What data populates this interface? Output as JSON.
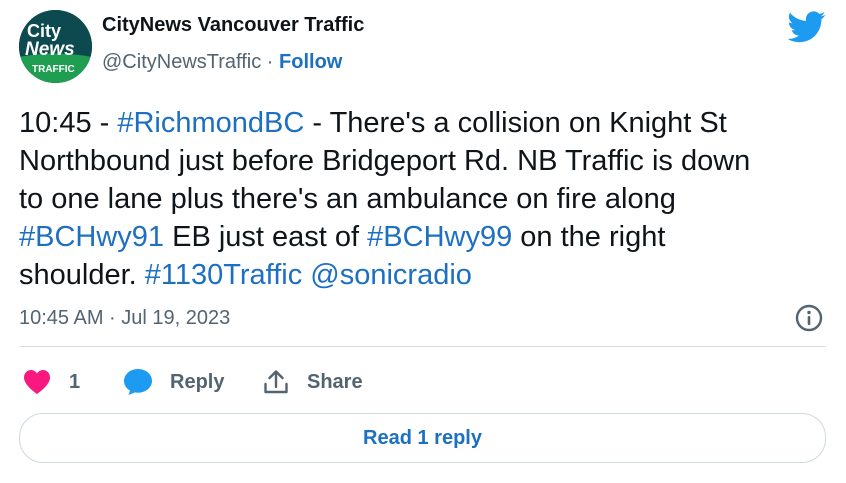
{
  "account": {
    "name": "CityNews Vancouver Traffic",
    "handle": "@CityNewsTraffic",
    "separator": "·",
    "follow_label": "Follow",
    "logo_line1": "City",
    "logo_line2": "News",
    "logo_line3": "TRAFFIC"
  },
  "tweet": {
    "segments": [
      {
        "text": "10:45 - ",
        "link": false
      },
      {
        "text": "#RichmondBC",
        "link": true
      },
      {
        "text": " - There's a collision on Knight St\nNorthbound just before Bridgeport Rd. NB Traffic is down\nto one lane plus there's an ambulance on fire along\n",
        "link": false
      },
      {
        "text": "#BCHwy91",
        "link": true
      },
      {
        "text": " EB just east of ",
        "link": false
      },
      {
        "text": "#BCHwy99",
        "link": true
      },
      {
        "text": " on the right\nshoulder. ",
        "link": false
      },
      {
        "text": "#1130Traffic",
        "link": true
      },
      {
        "text": " ",
        "link": false
      },
      {
        "text": "@sonicradio",
        "link": true
      }
    ]
  },
  "timestamp": "10:45 AM · Jul 19, 2023",
  "actions": {
    "like_count": "1",
    "reply_label": "Reply",
    "share_label": "Share"
  },
  "read_replies_label": "Read 1 reply",
  "colors": {
    "link": "#1d6fc2",
    "twitter_blue": "#1d9bf0",
    "heart": "#f91880",
    "muted": "#536471"
  },
  "icons": {
    "brand": "twitter-bird-icon",
    "info": "info-icon",
    "like": "heart-icon",
    "reply": "speech-bubble-icon",
    "share": "share-upload-icon"
  }
}
